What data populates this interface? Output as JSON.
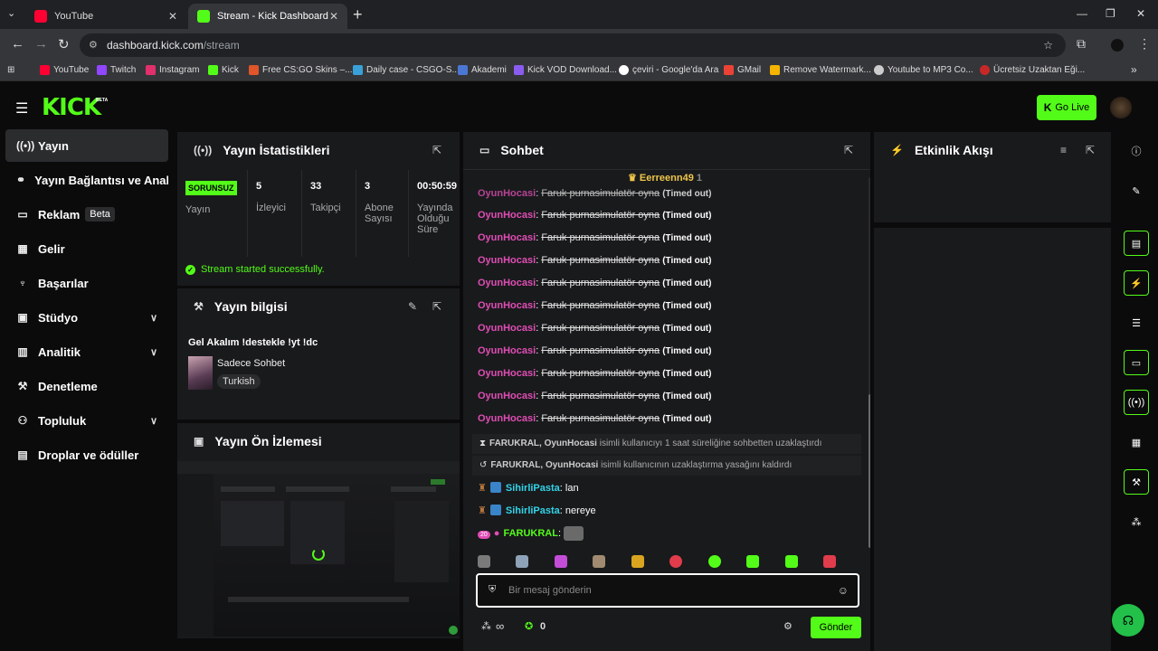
{
  "browser": {
    "tabs": [
      {
        "title": "YouTube",
        "icon": "youtube-icon"
      },
      {
        "title": "Stream - Kick Dashboard",
        "icon": "kick-icon"
      }
    ],
    "new_tab": "+",
    "url_host": "dashboard.kick.com",
    "url_path": "/stream",
    "bookmarks": [
      "YouTube",
      "Twitch",
      "Instagram",
      "Kick",
      "Free CS:GO Skins –...",
      "Daily case - CSGO-S...",
      "Akademi",
      "Kick VOD Download...",
      "çeviri - Google'da Ara",
      "GMail",
      "Remove Watermark...",
      "Youtube to MP3 Co...",
      "Ücretsiz Uzaktan Eği..."
    ],
    "bookmarks_more": "»"
  },
  "nav": {
    "logo": "KICK",
    "logo_badge": "BETA",
    "go_live": "Go Live"
  },
  "sidebar": {
    "items": [
      {
        "label": "Yayın",
        "icon": "broadcast-icon",
        "active": true
      },
      {
        "label": "Yayın Bağlantısı ve Anahtarı",
        "icon": "link-icon"
      },
      {
        "label": "Reklam",
        "icon": "ad-icon",
        "badge": "Beta"
      },
      {
        "label": "Gelir",
        "icon": "revenue-icon"
      },
      {
        "label": "Başarılar",
        "icon": "trophy-icon"
      },
      {
        "label": "Stüdyo",
        "icon": "studio-icon",
        "expandable": true
      },
      {
        "label": "Analitik",
        "icon": "analytics-icon",
        "expandable": true
      },
      {
        "label": "Denetleme",
        "icon": "wrench-icon"
      },
      {
        "label": "Topluluk",
        "icon": "community-icon",
        "expandable": true
      },
      {
        "label": "Droplar ve ödüller",
        "icon": "gift-icon"
      }
    ]
  },
  "stats_panel": {
    "title": "Yayın İstatistikleri",
    "columns": [
      {
        "value": "SORUNSUZ",
        "label": "Yayın"
      },
      {
        "value": "5",
        "label": "İzleyici"
      },
      {
        "value": "33",
        "label": "Takipçi"
      },
      {
        "value": "3",
        "label": "Abone Sayısı"
      },
      {
        "value": "00:50:59",
        "label": "Yayında Olduğu Süre"
      }
    ],
    "status_message": "Stream started successfully."
  },
  "info_panel": {
    "title": "Yayın bilgisi",
    "stream_title": "Gel Akalım !destekle !yt !dc",
    "category": "Sadece Sohbet",
    "language": "Turkish"
  },
  "preview_panel": {
    "title": "Yayın Ön İzlemesi"
  },
  "chat": {
    "title": "Sohbet",
    "pinned_user": "Eerreenn49",
    "pinned_count": "1",
    "timed_out_lines": [
      {
        "user": "OyunHocasi",
        "text": "Faruk purnasimulatör oyna",
        "tag": "(Timed out)"
      },
      {
        "user": "OyunHocasi",
        "text": "Faruk purnasimulatör oyna",
        "tag": "(Timed out)"
      },
      {
        "user": "OyunHocasi",
        "text": "Faruk purnasimulatör oyna",
        "tag": "(Timed out)"
      },
      {
        "user": "OyunHocasi",
        "text": "Faruk purnasimulatör oyna",
        "tag": "(Timed out)"
      },
      {
        "user": "OyunHocasi",
        "text": "Faruk purnasimulatör oyna",
        "tag": "(Timed out)"
      },
      {
        "user": "OyunHocasi",
        "text": "Faruk purnasimulatör oyna",
        "tag": "(Timed out)"
      },
      {
        "user": "OyunHocasi",
        "text": "Faruk purnasimulatör oyna",
        "tag": "(Timed out)"
      },
      {
        "user": "OyunHocasi",
        "text": "Faruk purnasimulatör oyna",
        "tag": "(Timed out)"
      },
      {
        "user": "OyunHocasi",
        "text": "Faruk purnasimulatör oyna",
        "tag": "(Timed out)"
      },
      {
        "user": "OyunHocasi",
        "text": "Faruk purnasimulatör oyna",
        "tag": "(Timed out)"
      },
      {
        "user": "OyunHocasi",
        "text": "Faruk purnasimulatör oyna",
        "tag": "(Timed out)"
      }
    ],
    "system_lines": [
      {
        "actors": "FARUKRAL, OyunHocasi",
        "text": "isimli kullanıcıyı 1 saat süreliğine sohbetten uzaklaştırdı",
        "icon": "hourglass-icon"
      },
      {
        "actors": "FARUKRAL, OyunHocasi",
        "text": "isimli kullanıcının uzaklaştırma yasağını kaldırdı",
        "icon": "undo-icon"
      }
    ],
    "messages": [
      {
        "user": "SihirliPasta",
        "text": "lan"
      },
      {
        "user": "SihirliPasta",
        "text": "nereye"
      },
      {
        "user": "FARUKRAL",
        "text": "",
        "sub_badge": "20"
      }
    ],
    "input_placeholder": "Bir mesaj gönderin",
    "points_label": "∞",
    "kicks_count": "0",
    "send_label": "Gönder"
  },
  "activity": {
    "title": "Etkinlik Akışı"
  },
  "colors": {
    "accent": "#53fc18",
    "timeout_user": "#e04db5",
    "mod_user": "#32d3e8",
    "pinned": "#f0c64a",
    "panel_bg": "#191a1c"
  }
}
